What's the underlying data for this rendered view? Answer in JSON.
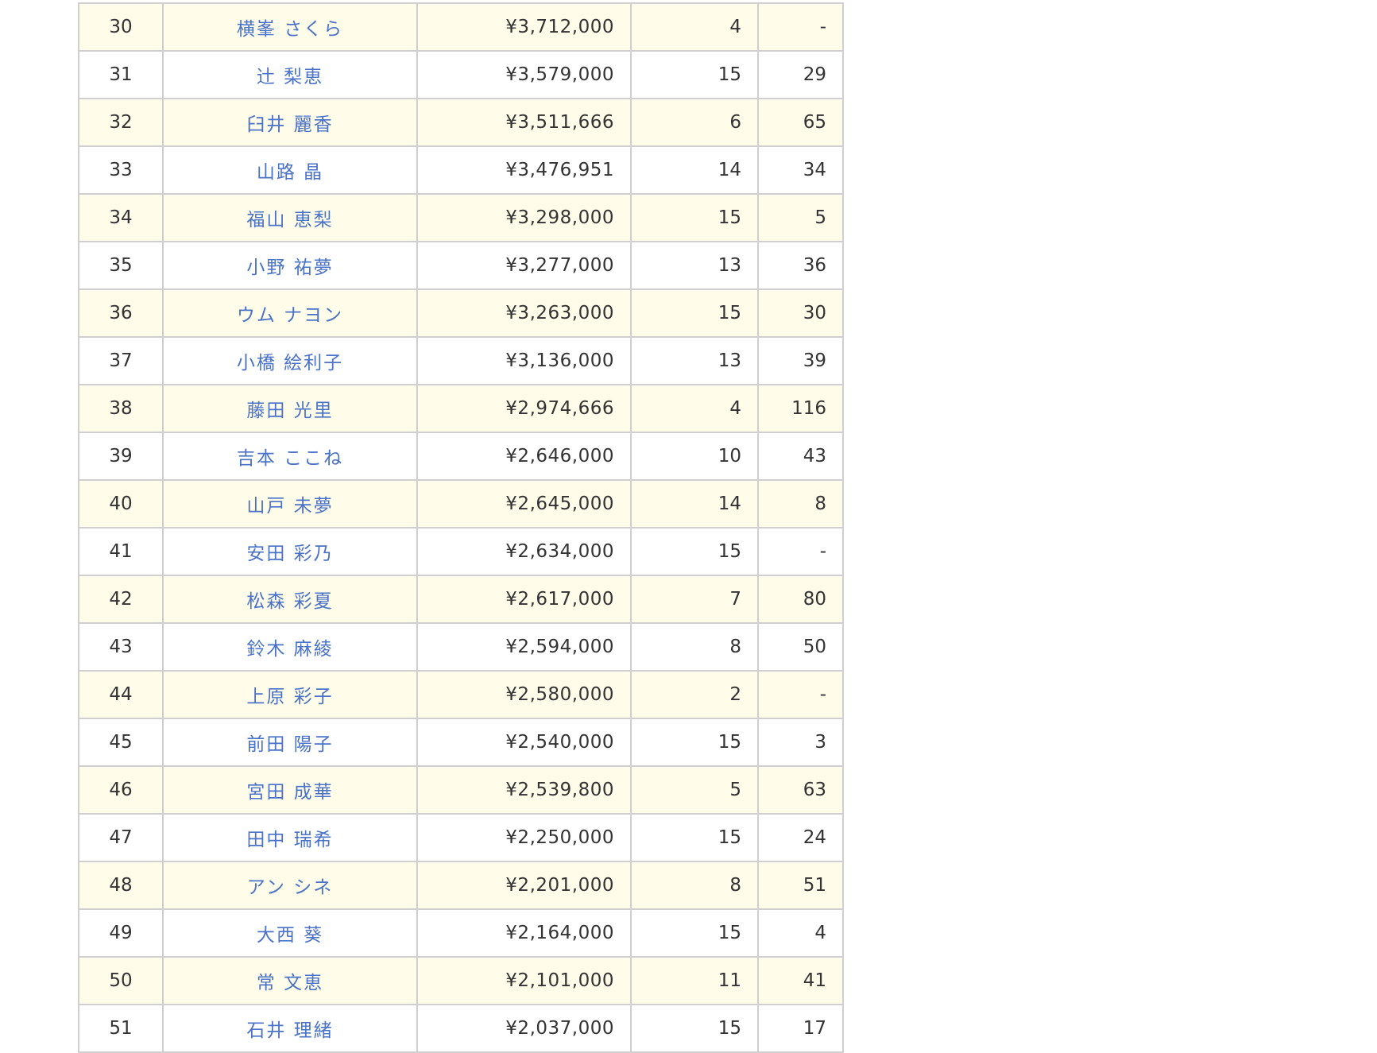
{
  "ranking": {
    "rows": [
      {
        "rank": "30",
        "name": "横峯 さくら",
        "prize": "¥3,712,000",
        "events": "4",
        "prev": "-"
      },
      {
        "rank": "31",
        "name": "辻 梨恵",
        "prize": "¥3,579,000",
        "events": "15",
        "prev": "29"
      },
      {
        "rank": "32",
        "name": "臼井 麗香",
        "prize": "¥3,511,666",
        "events": "6",
        "prev": "65"
      },
      {
        "rank": "33",
        "name": "山路 晶",
        "prize": "¥3,476,951",
        "events": "14",
        "prev": "34"
      },
      {
        "rank": "34",
        "name": "福山 恵梨",
        "prize": "¥3,298,000",
        "events": "15",
        "prev": "5"
      },
      {
        "rank": "35",
        "name": "小野 祐夢",
        "prize": "¥3,277,000",
        "events": "13",
        "prev": "36"
      },
      {
        "rank": "36",
        "name": "ウム ナヨン",
        "prize": "¥3,263,000",
        "events": "15",
        "prev": "30"
      },
      {
        "rank": "37",
        "name": "小橋 絵利子",
        "prize": "¥3,136,000",
        "events": "13",
        "prev": "39"
      },
      {
        "rank": "38",
        "name": "藤田 光里",
        "prize": "¥2,974,666",
        "events": "4",
        "prev": "116"
      },
      {
        "rank": "39",
        "name": "吉本 ここね",
        "prize": "¥2,646,000",
        "events": "10",
        "prev": "43"
      },
      {
        "rank": "40",
        "name": "山戸 未夢",
        "prize": "¥2,645,000",
        "events": "14",
        "prev": "8"
      },
      {
        "rank": "41",
        "name": "安田 彩乃",
        "prize": "¥2,634,000",
        "events": "15",
        "prev": "-"
      },
      {
        "rank": "42",
        "name": "松森 彩夏",
        "prize": "¥2,617,000",
        "events": "7",
        "prev": "80"
      },
      {
        "rank": "43",
        "name": "鈴木 麻綾",
        "prize": "¥2,594,000",
        "events": "8",
        "prev": "50"
      },
      {
        "rank": "44",
        "name": "上原 彩子",
        "prize": "¥2,580,000",
        "events": "2",
        "prev": "-"
      },
      {
        "rank": "45",
        "name": "前田 陽子",
        "prize": "¥2,540,000",
        "events": "15",
        "prev": "3"
      },
      {
        "rank": "46",
        "name": "宮田 成華",
        "prize": "¥2,539,800",
        "events": "5",
        "prev": "63"
      },
      {
        "rank": "47",
        "name": "田中 瑞希",
        "prize": "¥2,250,000",
        "events": "15",
        "prev": "24"
      },
      {
        "rank": "48",
        "name": "アン シネ",
        "prize": "¥2,201,000",
        "events": "8",
        "prev": "51"
      },
      {
        "rank": "49",
        "name": "大西 葵",
        "prize": "¥2,164,000",
        "events": "15",
        "prev": "4"
      },
      {
        "rank": "50",
        "name": "常 文恵",
        "prize": "¥2,101,000",
        "events": "11",
        "prev": "41"
      },
      {
        "rank": "51",
        "name": "石井 理緒",
        "prize": "¥2,037,000",
        "events": "15",
        "prev": "17"
      }
    ]
  },
  "colors": {
    "row_stripe": "#fffdea",
    "row_plain": "#ffffff",
    "border": "#cfcfcf",
    "link": "#4a72c9",
    "text": "#333333"
  }
}
